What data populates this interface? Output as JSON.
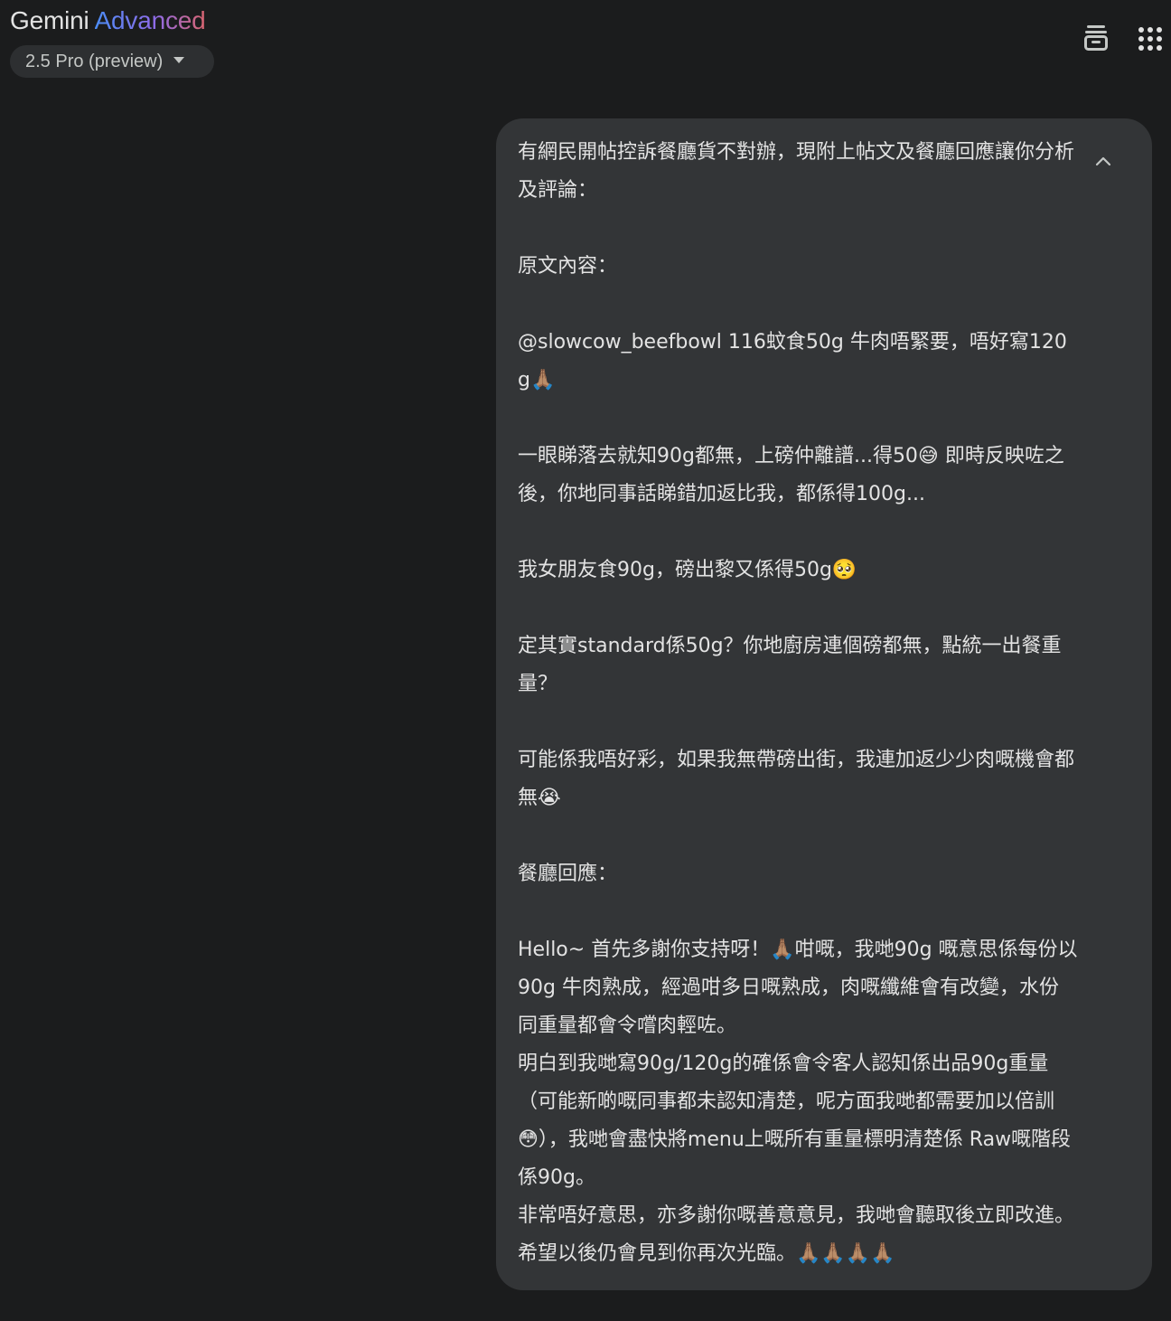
{
  "header": {
    "brand_name": "Gemini",
    "brand_tier": "Advanced",
    "model_selector": "2.5 Pro (preview)",
    "icons": {
      "history": "history-icon",
      "apps": "apps-grid-icon"
    }
  },
  "message": {
    "collapse_icon": "chevron-up-icon",
    "paragraphs": [
      "有網民開帖控訴餐廳貨不對辦，現附上帖文及餐廳回應讓你分析及評論：",
      "原文內容：",
      "@slowcow_beefbowl 116蚊食50g 牛肉唔緊要，唔好寫120g🙏🏽",
      "一眼睇落去就知90g都無，上磅仲離譜...得50😅 即時反映咗之後，你地同事話睇錯加返比我，都係得100g...",
      "我女朋友食90g，磅出黎又係得50g🥺",
      "定其實standard係50g？你地廚房連個磅都無，點統一出餐重量？",
      "可能係我唔好彩，如果我無帶磅出街，我連加返少少肉嘅機會都無😭",
      "餐廳回應：",
      "Hello~ 首先多謝你支持呀！🙏🏽咁嘅，我哋90g 嘅意思係每份以90g 牛肉熟成，經過咁多日嘅熟成，肉嘅纖維會有改變，水份同重量都會令嚐肉輕咗。",
      "明白到我哋寫90g/120g的確係會令客人認知係出品90g重量（可能新啲嘅同事都未認知清楚，呢方面我哋都需要加以倍訓 😳），我哋會盡快將menu上嘅所有重量標明清楚係 Raw嘅階段係90g。",
      "非常唔好意思，亦多謝你嘅善意意見，我哋會聽取後立即改進。希望以後仍會見到你再次光臨。🙏🏽🙏🏽🙏🏽🙏🏽"
    ]
  }
}
